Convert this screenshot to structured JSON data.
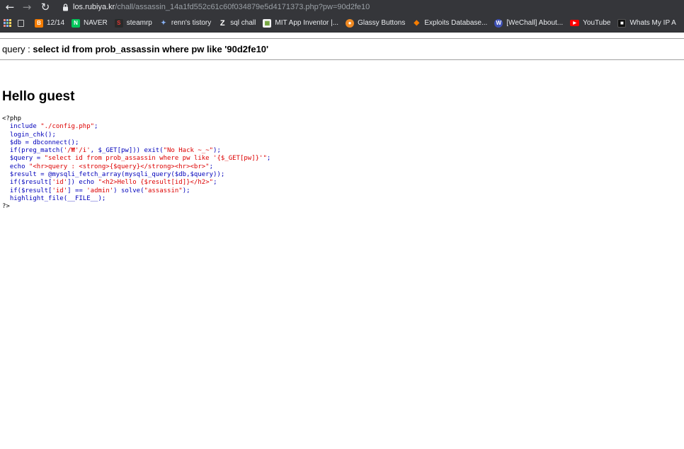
{
  "browser": {
    "url_host": "los.rubiya.kr",
    "url_path": "/chall/assassin_14a1fd552c61c60f034879e5d4171373.php?pw=90d2fe10"
  },
  "bookmarks": [
    {
      "label": "",
      "icon": "page-icon"
    },
    {
      "label": "12/14",
      "icon": "blogger-icon"
    },
    {
      "label": "NAVER",
      "icon": "naver-icon"
    },
    {
      "label": "steamrp",
      "icon": "steam-icon"
    },
    {
      "label": "renn's tistory",
      "icon": "tistory-icon"
    },
    {
      "label": "sql chall",
      "icon": "z-icon"
    },
    {
      "label": "MIT App Inventor |...",
      "icon": "app-inventor-icon"
    },
    {
      "label": "Glassy Buttons",
      "icon": "glassy-icon"
    },
    {
      "label": "Exploits Database...",
      "icon": "exploit-db-icon"
    },
    {
      "label": "[WeChall] About...",
      "icon": "wechall-icon"
    },
    {
      "label": "YouTube",
      "icon": "youtube-icon"
    },
    {
      "label": "Whats My IP A",
      "icon": "whatsmyip-icon"
    }
  ],
  "page": {
    "query_label": "query : ",
    "query_value": "select id from prob_assassin where pw like '90d2fe10'",
    "greeting": "Hello guest"
  },
  "source_code": [
    [
      {
        "c": "html",
        "t": "<?php"
      }
    ],
    [
      {
        "c": "def",
        "t": "  include "
      },
      {
        "c": "str",
        "t": "\"./config.php\""
      },
      {
        "c": "def",
        "t": ";"
      }
    ],
    [
      {
        "c": "def",
        "t": "  login_chk();"
      }
    ],
    [
      {
        "c": "def",
        "t": "  $db = dbconnect();"
      }
    ],
    [
      {
        "c": "def",
        "t": "  if(preg_match("
      },
      {
        "c": "str",
        "t": "'/₩'/i'"
      },
      {
        "c": "def",
        "t": ", $_GET[pw])) exit("
      },
      {
        "c": "str",
        "t": "\"No Hack ~_~\""
      },
      {
        "c": "def",
        "t": ");"
      }
    ],
    [
      {
        "c": "def",
        "t": "  $query = "
      },
      {
        "c": "str",
        "t": "\"select id from prob_assassin where pw like '{$_GET[pw]}'\""
      },
      {
        "c": "def",
        "t": ";"
      }
    ],
    [
      {
        "c": "def",
        "t": "  echo "
      },
      {
        "c": "str",
        "t": "\"<hr>query : <strong>{$query}</strong><hr><br>\""
      },
      {
        "c": "def",
        "t": ";"
      }
    ],
    [
      {
        "c": "def",
        "t": "  $result = @mysqli_fetch_array(mysqli_query($db,$query));"
      }
    ],
    [
      {
        "c": "def",
        "t": "  if($result["
      },
      {
        "c": "str",
        "t": "'id'"
      },
      {
        "c": "def",
        "t": "]) echo "
      },
      {
        "c": "str",
        "t": "\"<h2>Hello {$result[id]}</h2>\""
      },
      {
        "c": "def",
        "t": ";"
      }
    ],
    [
      {
        "c": "def",
        "t": "  if($result["
      },
      {
        "c": "str",
        "t": "'id'"
      },
      {
        "c": "def",
        "t": "] == "
      },
      {
        "c": "str",
        "t": "'admin'"
      },
      {
        "c": "def",
        "t": ") solve("
      },
      {
        "c": "str",
        "t": "\"assassin\""
      },
      {
        "c": "def",
        "t": ");"
      }
    ],
    [
      {
        "c": "def",
        "t": "  highlight_file(__FILE__);"
      }
    ],
    [
      {
        "c": "html",
        "t": "?>"
      }
    ]
  ]
}
